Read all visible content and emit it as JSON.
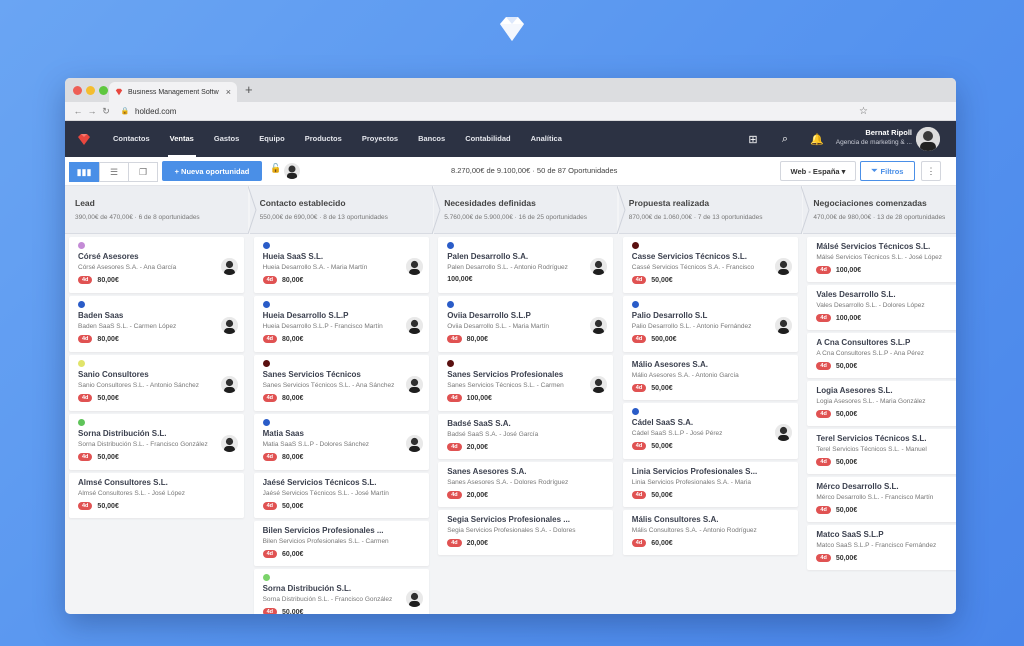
{
  "browser": {
    "tab_title": "Business Management Softw",
    "tab_close": "×",
    "new_tab": "+",
    "url": "holded.com",
    "back": "←",
    "forward": "→",
    "reload": "↻",
    "star": "☆"
  },
  "nav": {
    "items": [
      {
        "label": "Contactos"
      },
      {
        "label": "Ventas"
      },
      {
        "label": "Gastos"
      },
      {
        "label": "Equipo"
      },
      {
        "label": "Productos"
      },
      {
        "label": "Proyectos"
      },
      {
        "label": "Bancos"
      },
      {
        "label": "Contabilidad"
      },
      {
        "label": "Analítica"
      }
    ],
    "active": "Ventas",
    "user_name": "Bernat Ripoll",
    "user_company": "Agencia de marketing & ..."
  },
  "toolbar": {
    "new_button": "+ Nueva oportunidad",
    "summary": "8.270,00€ de 9.100,00€ · 50 de 87 Oportunidades",
    "select": "Web - España ▾",
    "filter": "Filtros",
    "more": "⋮"
  },
  "columns": [
    {
      "title": "Lead",
      "subtitle": "390,00€ de 470,00€ · 6 de 8 oportunidades",
      "cards": [
        {
          "dot": "#c48bd6",
          "name": "Córsé Asesores",
          "sub": "Córsé Asesores S.A. - Ana García",
          "badge": "4d",
          "amount": "80,00€",
          "avatar": true
        },
        {
          "dot": "#2a5cc8",
          "name": "Baden Saas",
          "sub": "Baden SaaS S.L. - Carmen López",
          "badge": "4d",
          "amount": "80,00€",
          "avatar": true
        },
        {
          "dot": "#e1e46a",
          "name": "Sanio Consultores",
          "sub": "Sanio Consultores S.L. - Antonio Sánchez",
          "badge": "4d",
          "amount": "50,00€",
          "avatar": true
        },
        {
          "dot": "#5fc45a",
          "name": "Sorna Distribución S.L.",
          "sub": "Sorna Distribución S.L. - Francisco González",
          "badge": "4d",
          "amount": "50,00€",
          "avatar": true
        },
        {
          "dot": "",
          "name": "Almsé Consultores S.L.",
          "sub": "Almsé Consultores S.L. - José López",
          "badge": "4d",
          "amount": "50,00€",
          "avatar": false
        }
      ]
    },
    {
      "title": "Contacto establecido",
      "subtitle": "550,00€ de 690,00€ · 8 de 13 oportunidades",
      "cards": [
        {
          "dot": "#2a5cc8",
          "name": "Hueia SaaS S.L.",
          "sub": "Hueia Desarrollo S.A. - Maria Martín",
          "badge": "4d",
          "amount": "80,00€",
          "avatar": true
        },
        {
          "dot": "#2a5cc8",
          "name": "Hueia Desarrollo S.L.P",
          "sub": "Hueia Desarrollo S.L.P - Francisco Martín",
          "badge": "4d",
          "amount": "80,00€",
          "avatar": true
        },
        {
          "dot": "#5a1010",
          "name": "Sanes Servicios Técnicos",
          "sub": "Sanes Servicios Técnicos S.L. - Ana Sánchez",
          "badge": "4d",
          "amount": "80,00€",
          "avatar": true
        },
        {
          "dot": "#2a5cc8",
          "name": "Matia Saas",
          "sub": "Matia SaaS S.L.P - Dolores Sánchez",
          "badge": "4d",
          "amount": "80,00€",
          "avatar": true
        },
        {
          "dot": "",
          "name": "Jaésé Servicios Técnicos S.L.",
          "sub": "Jaésé Servicios Técnicos S.L. - José Martín",
          "badge": "4d",
          "amount": "50,00€",
          "avatar": false
        },
        {
          "dot": "",
          "name": "Bilen Servicios Profesionales ...",
          "sub": "Bilen Servicios Profesionales S.L. - Carmen",
          "badge": "4d",
          "amount": "60,00€",
          "avatar": false
        },
        {
          "dot": "#7bd36a",
          "name": "Sorna Distribución S.L.",
          "sub": "Sorna Distribución S.L. - Francisco González",
          "badge": "4d",
          "amount": "50,00€",
          "avatar": true
        }
      ]
    },
    {
      "title": "Necesidades definidas",
      "subtitle": "5.760,00€ de 5.900,00€ · 16 de 25 oportunidades",
      "cards": [
        {
          "dot": "#2a5cc8",
          "name": "Palen Desarrollo S.A.",
          "sub": "Palen Desarrollo S.L. - Antonio Rodríguez",
          "badge": "",
          "amount": "100,00€",
          "avatar": true
        },
        {
          "dot": "#2a5cc8",
          "name": "Oviia Desarrollo S.L.P",
          "sub": "Oviia Desarrollo S.L. - Maria Martín",
          "badge": "4d",
          "amount": "80,00€",
          "avatar": true
        },
        {
          "dot": "#5a1010",
          "name": "Sanes Servicios Profesionales",
          "sub": "Sanes Servicios Técnicos S.L. - Carmen",
          "badge": "4d",
          "amount": "100,00€",
          "avatar": true
        },
        {
          "dot": "",
          "name": "Badsé SaaS S.A.",
          "sub": "Badsé SaaS S.A. - José García",
          "badge": "4d",
          "amount": "20,00€",
          "avatar": false
        },
        {
          "dot": "",
          "name": "Sanes Asesores S.A.",
          "sub": "Sanes Asesores S.A. - Dolores Rodríguez",
          "badge": "4d",
          "amount": "20,00€",
          "avatar": false
        },
        {
          "dot": "",
          "name": "Segia Servicios Profesionales ...",
          "sub": "Segia Servicios Profesionales S.A. - Dolores",
          "badge": "4d",
          "amount": "20,00€",
          "avatar": false
        }
      ]
    },
    {
      "title": "Propuesta realizada",
      "subtitle": "870,00€ de 1.060,00€ · 7 de 13 oportunidades",
      "cards": [
        {
          "dot": "#5a1010",
          "name": "Casse Servicios Técnicos S.L.",
          "sub": "Cassé Servicios Técnicos S.A. - Francisco",
          "badge": "4d",
          "amount": "50,00€",
          "avatar": true
        },
        {
          "dot": "#2a5cc8",
          "name": "Palio Desarrollo S.L",
          "sub": "Palio Desarrollo S.L. - Antonio Fernández",
          "badge": "4d",
          "amount": "500,00€",
          "avatar": true
        },
        {
          "dot": "",
          "name": "Málio Asesores S.A.",
          "sub": "Málio Asesores S.A. - Antonio García",
          "badge": "4d",
          "amount": "50,00€",
          "avatar": false
        },
        {
          "dot": "#2a5cc8",
          "name": "Cádel SaaS S.A.",
          "sub": "Cádel SaaS S.L.P - José Pérez",
          "badge": "4d",
          "amount": "50,00€",
          "avatar": true
        },
        {
          "dot": "",
          "name": "Linia Servicios Profesionales S...",
          "sub": "Linia Servicios Profesionales S.A. - Maria",
          "badge": "4d",
          "amount": "50,00€",
          "avatar": false
        },
        {
          "dot": "",
          "name": "Mális Consultores S.A.",
          "sub": "Mális Consultores S.A. - Antonio Rodríguez",
          "badge": "4d",
          "amount": "60,00€",
          "avatar": false
        }
      ]
    },
    {
      "title": "Negociaciones comenzadas",
      "subtitle": "470,00€ de 980,00€ · 13 de 28 oportunidades",
      "cards": [
        {
          "dot": "",
          "name": "Málsé Servicios Técnicos S.L.",
          "sub": "Málsé Servicios Técnicos S.L. - José López",
          "badge": "4d",
          "amount": "100,00€",
          "avatar": false
        },
        {
          "dot": "",
          "name": "Vales Desarrollo S.L.",
          "sub": "Vales Desarrollo S.L. - Dolores López",
          "badge": "4d",
          "amount": "100,00€",
          "avatar": false
        },
        {
          "dot": "",
          "name": "A Cna Consultores S.L.P",
          "sub": "A Cna Consultores S.L.P - Ana Pérez",
          "badge": "4d",
          "amount": "50,00€",
          "avatar": false
        },
        {
          "dot": "",
          "name": "Logia Asesores S.L.",
          "sub": "Logia Asesores S.L. - Maria González",
          "badge": "4d",
          "amount": "50,00€",
          "avatar": false
        },
        {
          "dot": "",
          "name": "Terel Servicios Técnicos S.L.",
          "sub": "Terel Servicios Técnicos S.L. - Manuel",
          "badge": "4d",
          "amount": "50,00€",
          "avatar": false
        },
        {
          "dot": "",
          "name": "Mérco Desarrollo S.L.",
          "sub": "Mérco Desarrollo S.L. - Francisco Martín",
          "badge": "4d",
          "amount": "50,00€",
          "avatar": false
        },
        {
          "dot": "",
          "name": "Matco SaaS S.L.P",
          "sub": "Matco SaaS S.L.P - Francisco Fernández",
          "badge": "4d",
          "amount": "50,00€",
          "avatar": false
        }
      ]
    }
  ],
  "colors": {
    "accent": "#4a8fe7",
    "nav_bg": "#2c3243",
    "badge": "#e05252",
    "brand": "#e8473f"
  }
}
